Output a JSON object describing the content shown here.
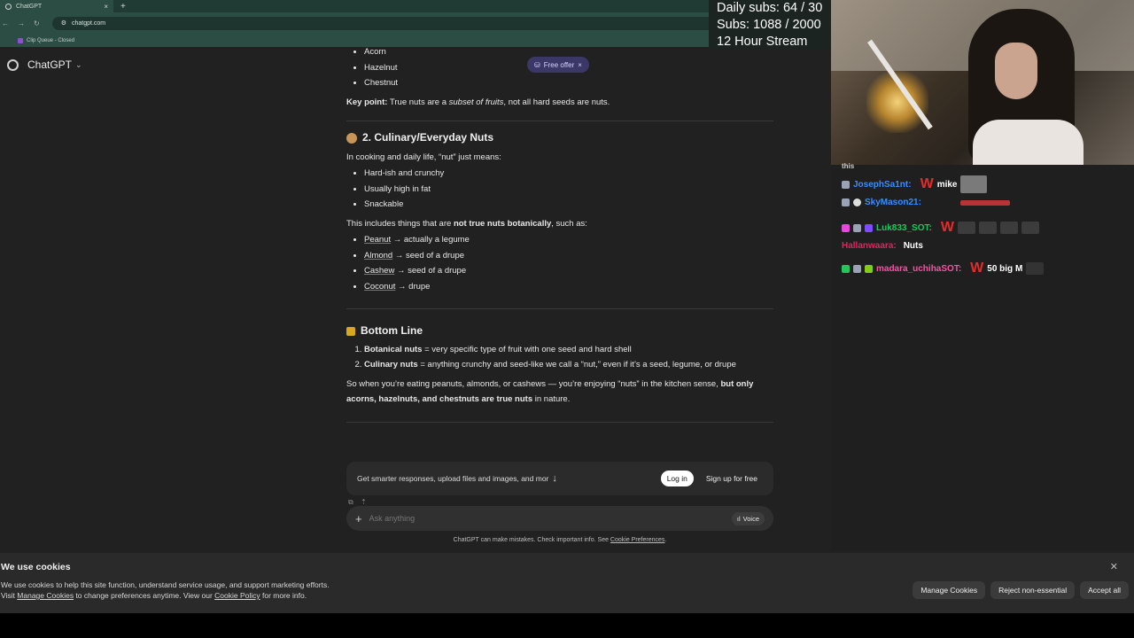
{
  "browser": {
    "tab_title": "ChatGPT",
    "tab_close": "×",
    "new_tab": "+",
    "url": "chatgpt.com",
    "bookmark": "Clip Queue - Closed"
  },
  "gpt": {
    "title": "ChatGPT",
    "free_offer": "Free offer",
    "free_offer_close": "×"
  },
  "content": {
    "top_list": [
      "Acorn",
      "Hazelnut",
      "Chestnut"
    ],
    "key_point_label": "Key point:",
    "key_point_a": " True nuts are a ",
    "key_point_em": "subset of fruits",
    "key_point_b": ", not all hard seeds are nuts.",
    "section2_title": "2. Culinary/Everyday Nuts",
    "section2_intro": "In cooking and daily life, “nut” just means:",
    "section2_list": [
      "Hard-ish and crunchy",
      "Usually high in fat",
      "Snackable"
    ],
    "includes_a": "This includes things that are ",
    "includes_b": "not true nuts botanically",
    "includes_c": ", such as:",
    "examples": [
      {
        "name": "Peanut",
        "desc": " → actually a legume"
      },
      {
        "name": "Almond",
        "desc": " → seed of a drupe"
      },
      {
        "name": "Cashew",
        "desc": " → seed of a drupe"
      },
      {
        "name": "Coconut",
        "desc": " → drupe"
      }
    ],
    "bottom_title": "Bottom Line",
    "bottom_list": [
      {
        "bold": "Botanical nuts",
        "rest": " = very specific type of fruit with one seed and hard shell"
      },
      {
        "bold": "Culinary nuts",
        "rest": " = anything crunchy and seed-like we call a “nut,” even if it’s a seed, legume, or drupe"
      }
    ],
    "summary_a": "So when you’re eating peanuts, almonds, or cashews — you’re enjoying “nuts” in the kitchen sense, ",
    "summary_b": "but only acorns, hazelnuts, and chestnuts are true nuts",
    "summary_c": " in nature."
  },
  "login_banner": {
    "text": "Get smarter responses, upload files and images, and mor",
    "login": "Log in",
    "signup": "Sign up for free"
  },
  "composer": {
    "placeholder": "Ask anything",
    "voice": "Voice",
    "disclaimer_a": "ChatGPT can make mistakes. Check important info. See ",
    "disclaimer_link": "Cookie Preferences",
    "disclaimer_b": "."
  },
  "cookie": {
    "title": "We use cookies",
    "line1": "We use cookies to help this site function, understand service usage, and support marketing efforts.",
    "line2_a": "Visit ",
    "manage_link": "Manage Cookies",
    "line2_b": " to change preferences anytime. View our ",
    "policy_link": "Cookie Policy",
    "line2_c": " for more info.",
    "btn_manage": "Manage Cookies",
    "btn_reject": "Reject non-essential",
    "btn_accept": "Accept all"
  },
  "overlay": {
    "daily": "Daily subs: 64 / 30",
    "subs": "Subs: 1088 / 2000",
    "stream": "12 Hour Stream"
  },
  "chat": {
    "cut_text": "this",
    "messages": [
      {
        "user": "JosephSa1nt:",
        "color": "#3b8cff",
        "w": "W",
        "text": "mike"
      },
      {
        "user": "SkyMason21:",
        "color": "#3b8cff",
        "w": "",
        "text": ""
      },
      {
        "user": "Luk833_SOT:",
        "color": "#22c55e",
        "w": "W",
        "text": ""
      },
      {
        "user": "Hallanwaara:",
        "color": "#e0245e",
        "w": "",
        "text": "Nuts"
      },
      {
        "user": "madara_uchihaSOT:",
        "color": "#ff4fa3",
        "w": "W",
        "text": "50 big M"
      }
    ]
  },
  "colors": {
    "bg": "#212121",
    "chat_bg": "#1f1f1f",
    "free_offer_bg": "#3b3766",
    "accent_w": "#e32c2c"
  }
}
